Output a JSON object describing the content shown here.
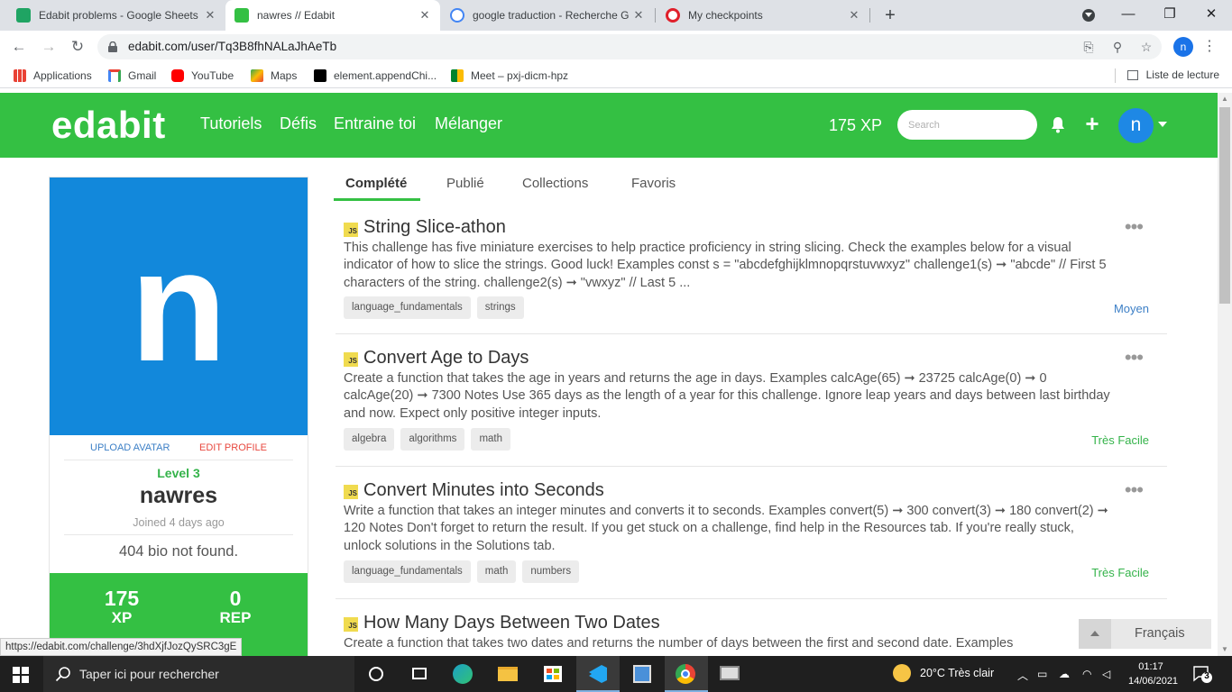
{
  "browser": {
    "tabs": [
      {
        "title": "Edabit problems - Google Sheets",
        "icon": "sheets-icon"
      },
      {
        "title": "nawres // Edabit",
        "icon": "edabit-favicon"
      },
      {
        "title": "google traduction - Recherche G",
        "icon": "google-icon"
      },
      {
        "title": "My checkpoints",
        "icon": "opera-icon"
      }
    ],
    "new_tab": "+",
    "url": "edabit.com/user/Tq3B8fhNALaJhAeTb",
    "profile_initial": "n",
    "bookmarks": [
      {
        "label": "Applications",
        "icon": "apps-grid-icon"
      },
      {
        "label": "Gmail",
        "icon": "gmail-icon"
      },
      {
        "label": "YouTube",
        "icon": "youtube-icon"
      },
      {
        "label": "Maps",
        "icon": "maps-icon"
      },
      {
        "label": "element.appendChi...",
        "icon": "codepen-icon"
      },
      {
        "label": "Meet – pxj-dicm-hpz",
        "icon": "meet-icon"
      }
    ],
    "reading_list": "Liste de lecture",
    "status_url": "https://edabit.com/challenge/3hdXjfJozQySRC3gE"
  },
  "header": {
    "logo": "edabit",
    "nav": [
      "Tutoriels",
      "Défis",
      "Entraine toi",
      "Mélanger"
    ],
    "xp": "175 XP",
    "search_placeholder": "Search",
    "avatar_initial": "n"
  },
  "profile": {
    "avatar_letter": "n",
    "upload_avatar": "UPLOAD AVATAR",
    "edit_profile": "EDIT PROFILE",
    "level": "Level 3",
    "username": "nawres",
    "joined": "Joined 4 days ago",
    "bio": "404 bio not found.",
    "xp_value": "175",
    "xp_label": "XP",
    "rep_value": "0",
    "rep_label": "REP"
  },
  "tabs": [
    "Complété",
    "Publié",
    "Collections",
    "Favoris"
  ],
  "challenges": [
    {
      "lang": "JS",
      "title": "String Slice-athon",
      "description": "This challenge has five miniature exercises to help practice proficiency in string slicing. Check the examples below for a visual indicator of how to slice the strings. Good luck! Examples const s = \"abcdefghijklmnopqrstuvwxyz\" challenge1(s) ➞ \"abcde\" // First 5 characters of the string. challenge2(s) ➞ \"vwxyz\" // Last 5 ...",
      "tags": [
        "language_fundamentals",
        "strings"
      ],
      "difficulty": "Moyen",
      "difficulty_color": "#3c7fc6",
      "menu": "•••"
    },
    {
      "lang": "JS",
      "title": "Convert Age to Days",
      "description": "Create a function that takes the age in years and returns the age in days. Examples calcAge(65) ➞ 23725 calcAge(0) ➞ 0 calcAge(20) ➞ 7300 Notes Use 365 days as the length of a year for this challenge. Ignore leap years and days between last birthday and now. Expect only positive integer inputs.",
      "tags": [
        "algebra",
        "algorithms",
        "math"
      ],
      "difficulty": "Très Facile",
      "difficulty_color": "#34b34a",
      "menu": "•••"
    },
    {
      "lang": "JS",
      "title": "Convert Minutes into Seconds",
      "description": "Write a function that takes an integer minutes and converts it to seconds. Examples convert(5) ➞ 300 convert(3) ➞ 180 convert(2) ➞ 120 Notes Don't forget to return the result. If you get stuck on a challenge, find help in the Resources tab. If you're really stuck, unlock solutions in the Solutions tab.",
      "tags": [
        "language_fundamentals",
        "math",
        "numbers"
      ],
      "difficulty": "Très Facile",
      "difficulty_color": "#34b34a",
      "menu": "•••"
    },
    {
      "lang": "JS",
      "title": "How Many Days Between Two Dates",
      "description": "Create a function that takes two dates and returns the number of days between the first and second date. Examples",
      "tags": [],
      "difficulty": "",
      "difficulty_color": "#34b34a",
      "menu": ""
    }
  ],
  "language_widget": "Français",
  "taskbar": {
    "search_placeholder": "Taper ici pour rechercher",
    "weather": "20°C  Très clair",
    "time": "01:17",
    "date": "14/06/2021",
    "notifications": "3"
  },
  "colors": {
    "brand_green": "#34c043",
    "avatar_blue": "#1288db",
    "link_blue": "#3c7fc6",
    "edit_red": "#e8483f"
  }
}
